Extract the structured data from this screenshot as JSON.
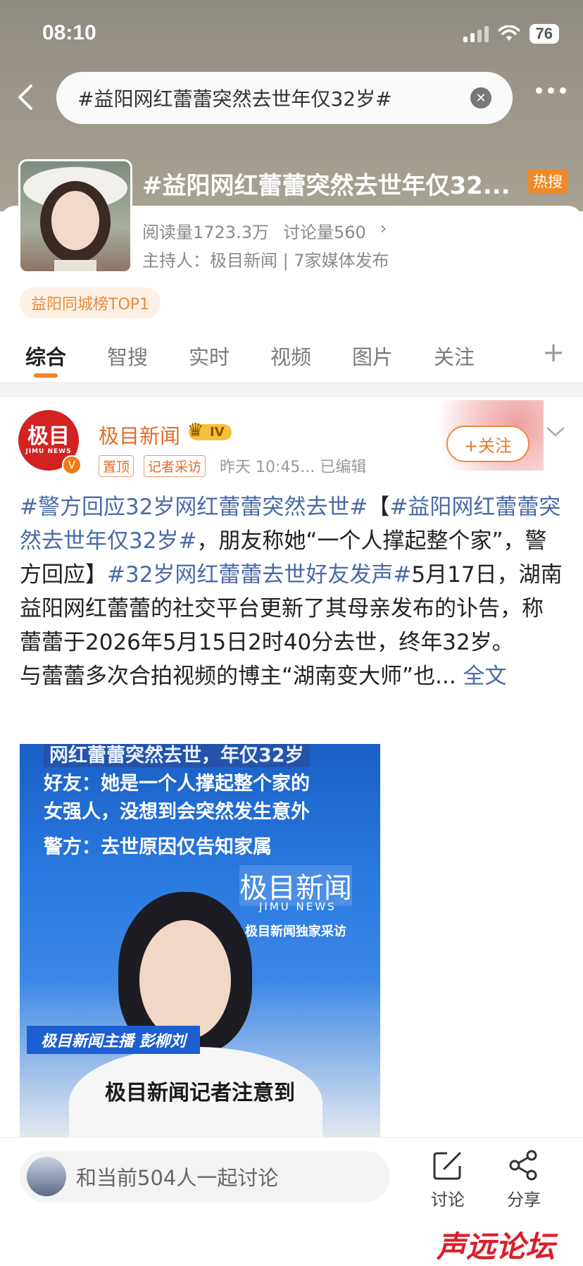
{
  "status_bar": {
    "time": "08:10",
    "battery": "76"
  },
  "search": {
    "query": "#益阳网红蕾蕾突然去世年仅32岁#"
  },
  "topic": {
    "title": "#益阳网红蕾蕾突然去世年仅32...",
    "hot_badge": "热搜",
    "reads": "阅读量1723.3万",
    "discussions": "讨论量560",
    "host": "主持人：极目新闻 | 7家媒体发布",
    "rank_badge": "益阳同城榜TOP1"
  },
  "tabs": [
    "综合",
    "智搜",
    "实时",
    "视频",
    "图片",
    "关注"
  ],
  "post": {
    "logo_text": "极目",
    "logo_sub": "JIMU NEWS",
    "author": "极目新闻",
    "level": "IV",
    "tags": [
      "置顶",
      "记者采访"
    ],
    "time": "昨天 10:45...  已编辑",
    "follow_label": "+关注",
    "content": {
      "tag1": "#警方回应32岁网红蕾蕾突然去世#",
      "bracket_open": "【",
      "tag2": "#益阳网红蕾蕾突然去世年仅32岁#",
      "text1": "，朋友称她“一个人撑起整个家”，警方回应】",
      "tag3": "#32岁网红蕾蕾去世好友发声#",
      "text2": "5月17日，湖南益阳网红蕾蕾的社交平台更新了其母亲发布的讣告，称蕾蕾于2026年5月15日2时40分去世，终年32岁。",
      "text3": "与蕾蕾多次合拍视频的博主“湖南变大师”也...",
      "more": "全文"
    },
    "video": {
      "line0": "网红蕾蕾突然去世，年仅32岁",
      "line1": "好友：她是一个人撑起整个家的",
      "line2": "女强人，没想到会突然发生意外",
      "line3": "警方：去世原因仅告知家属",
      "logo": "极目新闻",
      "logo_en": "JIMU NEWS",
      "exclusive": "极目新闻独家采访",
      "anchor": "极目新闻主播  彭柳刘",
      "caption": "极目新闻记者注意到"
    }
  },
  "bottom": {
    "discuss_placeholder": "和当前504人一起讨论",
    "discuss_label": "讨论",
    "share_label": "分享"
  },
  "watermark": "声远论坛",
  "colors": {
    "accent": "#f5822a",
    "link": "#4a6aa8",
    "hot": "#f08a27"
  }
}
